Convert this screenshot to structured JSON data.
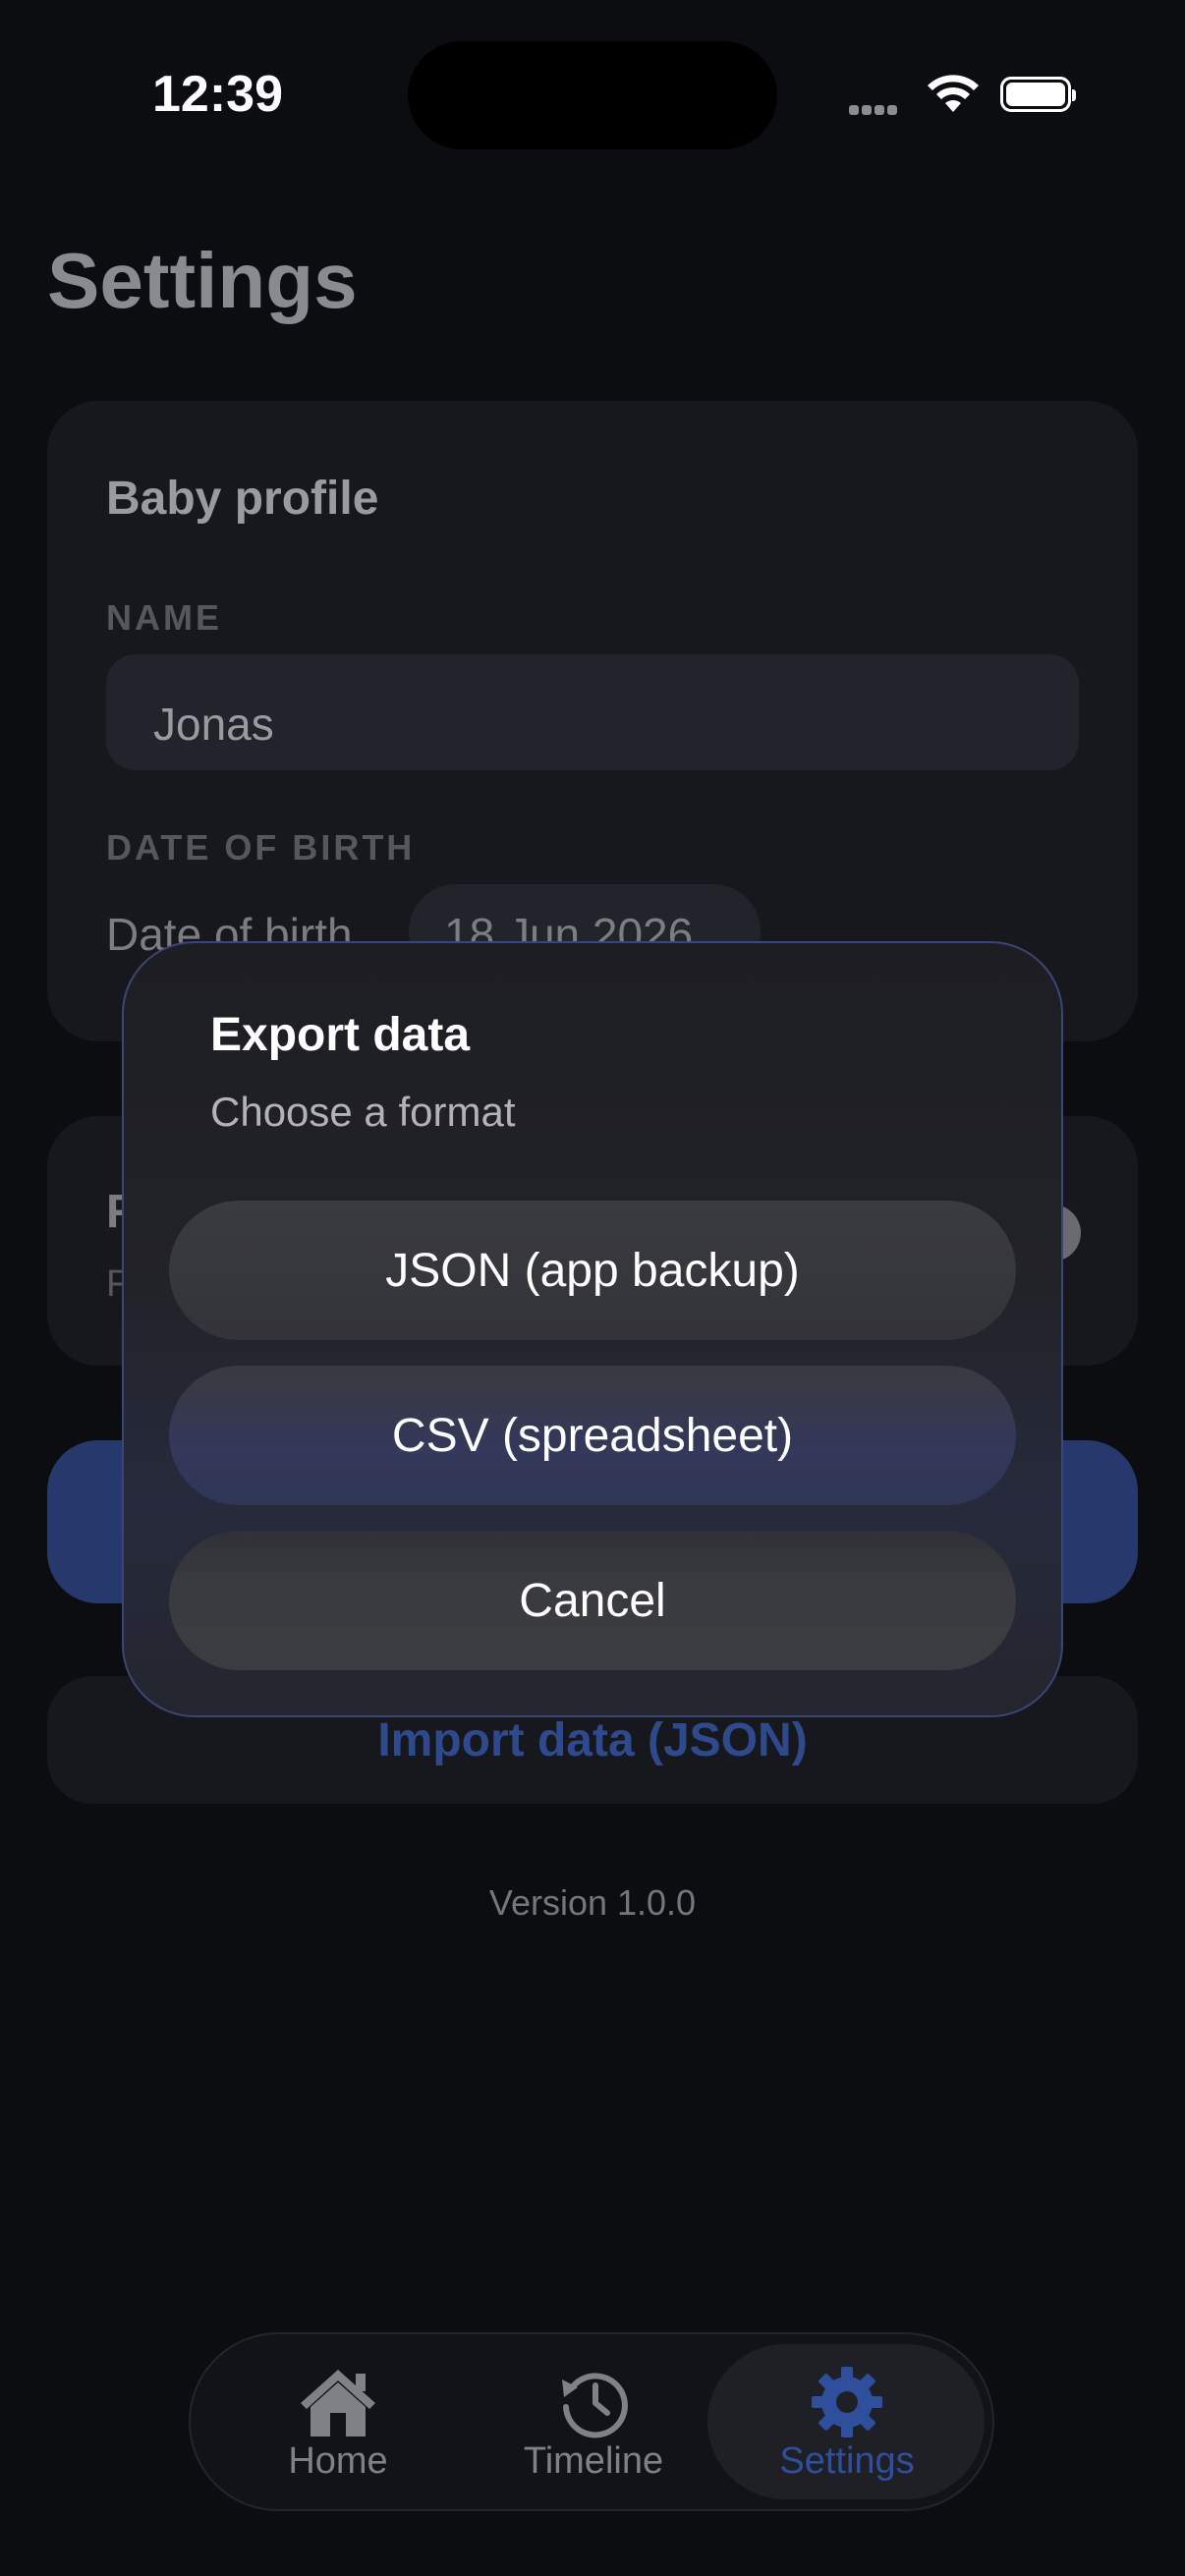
{
  "status_bar": {
    "time": "12:39"
  },
  "page": {
    "title": "Settings"
  },
  "profile_card": {
    "title": "Baby profile",
    "name_label": "NAME",
    "name_value": "Jonas",
    "dob_label": "DATE OF BIRTH",
    "dob_text": "Date of birth",
    "dob_value": "18 Jun 2026"
  },
  "reminder_card": {
    "title_partial": "F",
    "subtitle_partial": "F"
  },
  "import_button": {
    "label": "Import data (JSON)"
  },
  "version": "Version 1.0.0",
  "dialog": {
    "title": "Export data",
    "subtitle": "Choose a format",
    "options": [
      {
        "label": "JSON (app backup)"
      },
      {
        "label": "CSV (spreadsheet)"
      },
      {
        "label": "Cancel"
      }
    ]
  },
  "tab_bar": {
    "tabs": [
      {
        "label": "Home",
        "icon": "house-icon"
      },
      {
        "label": "Timeline",
        "icon": "history-clock-icon"
      },
      {
        "label": "Settings",
        "icon": "gear-icon",
        "active": true
      }
    ],
    "active_color": "#2f4f9c"
  },
  "colors": {
    "accent": "#2f4f9c",
    "background": "#0c0d11"
  }
}
